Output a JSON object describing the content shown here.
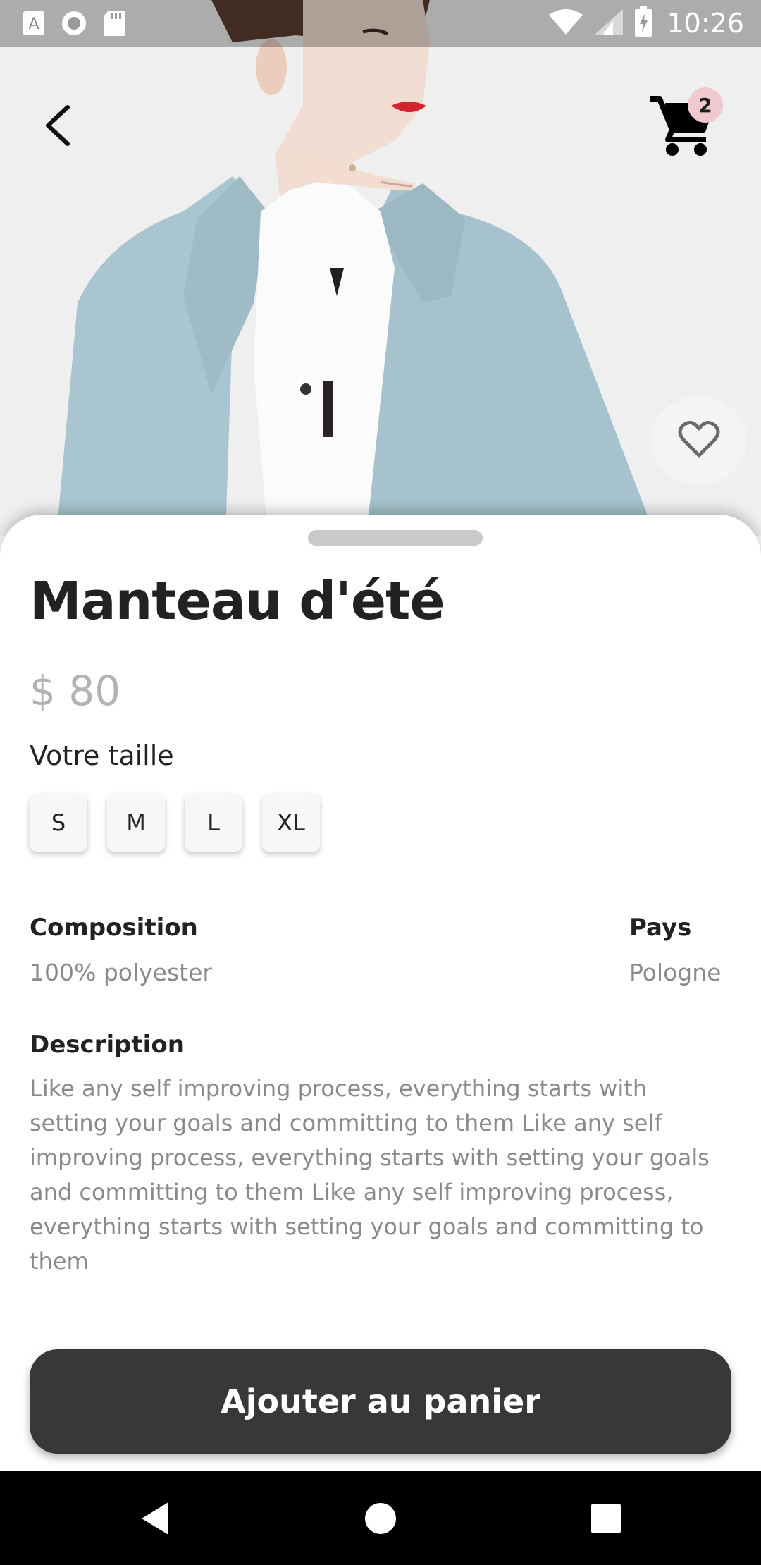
{
  "status_bar": {
    "time": "10:26",
    "left_icons": [
      "text-a-icon",
      "circle-icon",
      "sd-card-icon"
    ],
    "right_icons": [
      "wifi-icon",
      "signal-icon",
      "battery-icon"
    ]
  },
  "header": {
    "back_icon": "back-arrow-icon",
    "cart_icon": "cart-icon",
    "cart_count": "2",
    "favorite_icon": "heart-outline-icon"
  },
  "product": {
    "title": "Manteau d'été",
    "price": "$ 80",
    "size_label": "Votre taille",
    "sizes": [
      "S",
      "M",
      "L",
      "XL"
    ],
    "composition_heading": "Composition",
    "composition_value": "100% polyester",
    "country_heading": "Pays",
    "country_value": "Pologne",
    "description_heading": "Description",
    "description_text": "Like any self improving process, everything starts with setting your goals and committing to them Like any self improving process, everything starts with setting your goals and committing to them Like any self improving process, everything starts with setting your goals and committing to them"
  },
  "actions": {
    "add_to_cart_label": "Ajouter au panier"
  },
  "nav_bar": {
    "icons": [
      "nav-back-icon",
      "nav-home-icon",
      "nav-recents-icon"
    ]
  },
  "colors": {
    "button_bg": "#383838",
    "badge_bg": "#f0c9cf",
    "price_text": "#b3b3b3",
    "coat": "#a9c5cf"
  }
}
